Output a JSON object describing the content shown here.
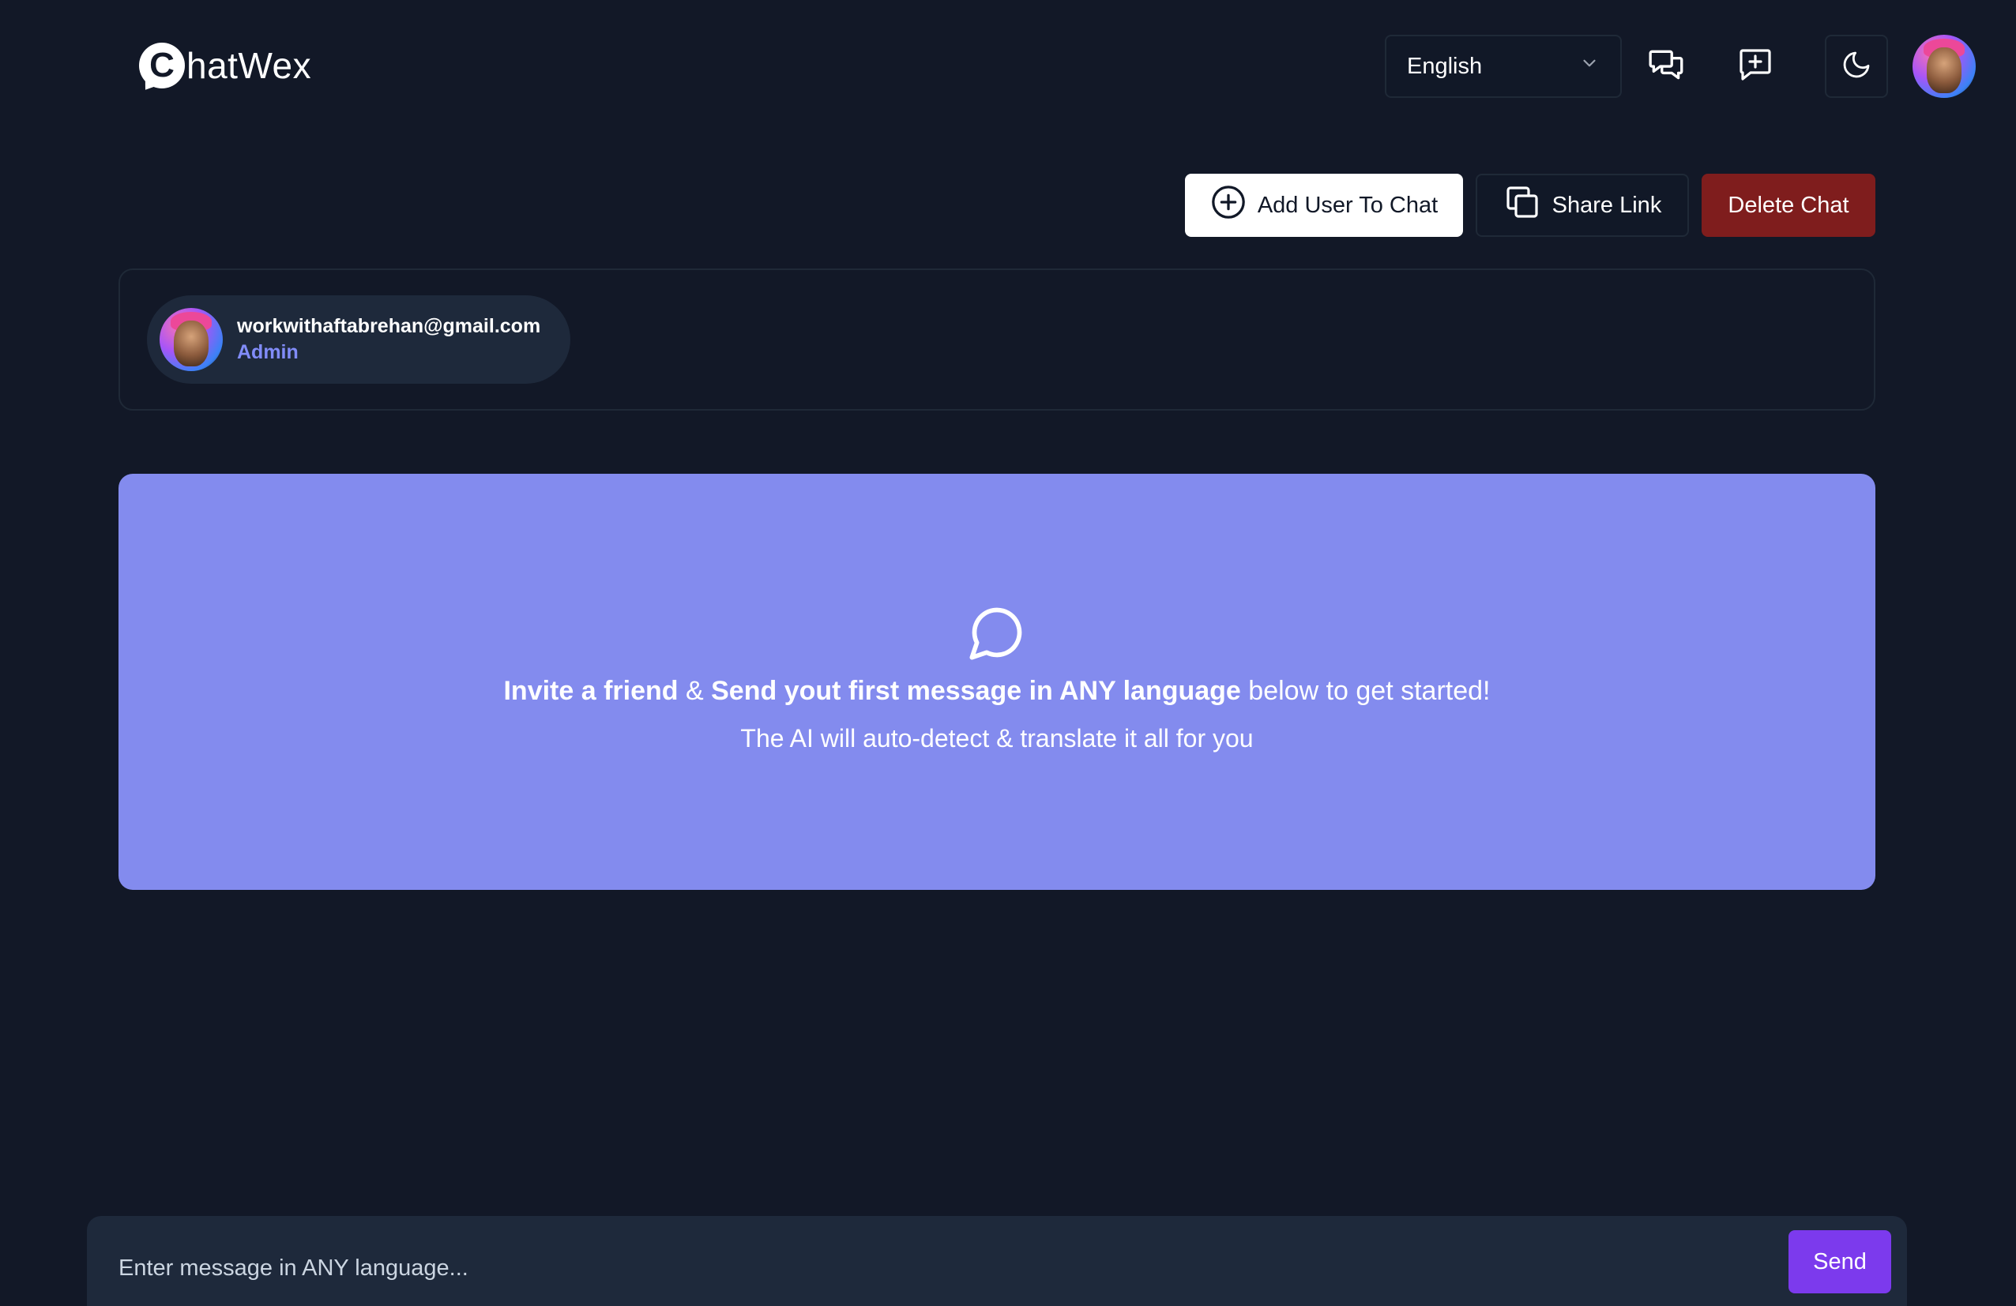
{
  "app": {
    "logo_letter": "C",
    "logo_text": "hatWex"
  },
  "header": {
    "language_selected": "English",
    "icons": [
      "chats-icon",
      "new-chat-icon",
      "moon-icon",
      "profile-avatar"
    ]
  },
  "actions": {
    "add_user_label": "Add User To Chat",
    "share_link_label": "Share Link",
    "delete_chat_label": "Delete Chat"
  },
  "participants": [
    {
      "email": "workwithaftabrehan@gmail.com",
      "role": "Admin"
    }
  ],
  "empty_state": {
    "invite": "Invite a friend",
    "amp": " & ",
    "send": "Send yout first message in ANY language",
    "rest": " below to get started!",
    "subline": "The AI will auto-detect & translate it all for you"
  },
  "composer": {
    "placeholder": "Enter message in ANY language...",
    "send_label": "Send"
  },
  "colors": {
    "background": "#121827",
    "card": "#838bee",
    "delete": "#7f1d1d",
    "send": "#7c3aed",
    "role": "#818cf8"
  }
}
